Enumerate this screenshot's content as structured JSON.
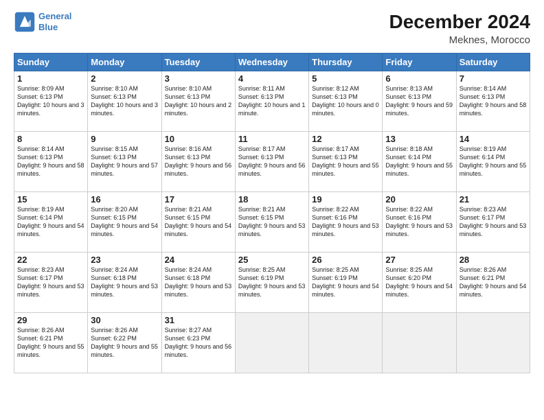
{
  "header": {
    "logo_line1": "General",
    "logo_line2": "Blue",
    "month": "December 2024",
    "location": "Meknes, Morocco"
  },
  "weekdays": [
    "Sunday",
    "Monday",
    "Tuesday",
    "Wednesday",
    "Thursday",
    "Friday",
    "Saturday"
  ],
  "weeks": [
    [
      {
        "num": "1",
        "sunrise": "8:09 AM",
        "sunset": "6:13 PM",
        "daylight": "10 hours and 3 minutes."
      },
      {
        "num": "2",
        "sunrise": "8:10 AM",
        "sunset": "6:13 PM",
        "daylight": "10 hours and 3 minutes."
      },
      {
        "num": "3",
        "sunrise": "8:10 AM",
        "sunset": "6:13 PM",
        "daylight": "10 hours and 2 minutes."
      },
      {
        "num": "4",
        "sunrise": "8:11 AM",
        "sunset": "6:13 PM",
        "daylight": "10 hours and 1 minute."
      },
      {
        "num": "5",
        "sunrise": "8:12 AM",
        "sunset": "6:13 PM",
        "daylight": "10 hours and 0 minutes."
      },
      {
        "num": "6",
        "sunrise": "8:13 AM",
        "sunset": "6:13 PM",
        "daylight": "9 hours and 59 minutes."
      },
      {
        "num": "7",
        "sunrise": "8:14 AM",
        "sunset": "6:13 PM",
        "daylight": "9 hours and 58 minutes."
      }
    ],
    [
      {
        "num": "8",
        "sunrise": "8:14 AM",
        "sunset": "6:13 PM",
        "daylight": "9 hours and 58 minutes."
      },
      {
        "num": "9",
        "sunrise": "8:15 AM",
        "sunset": "6:13 PM",
        "daylight": "9 hours and 57 minutes."
      },
      {
        "num": "10",
        "sunrise": "8:16 AM",
        "sunset": "6:13 PM",
        "daylight": "9 hours and 56 minutes."
      },
      {
        "num": "11",
        "sunrise": "8:17 AM",
        "sunset": "6:13 PM",
        "daylight": "9 hours and 56 minutes."
      },
      {
        "num": "12",
        "sunrise": "8:17 AM",
        "sunset": "6:13 PM",
        "daylight": "9 hours and 55 minutes."
      },
      {
        "num": "13",
        "sunrise": "8:18 AM",
        "sunset": "6:14 PM",
        "daylight": "9 hours and 55 minutes."
      },
      {
        "num": "14",
        "sunrise": "8:19 AM",
        "sunset": "6:14 PM",
        "daylight": "9 hours and 55 minutes."
      }
    ],
    [
      {
        "num": "15",
        "sunrise": "8:19 AM",
        "sunset": "6:14 PM",
        "daylight": "9 hours and 54 minutes."
      },
      {
        "num": "16",
        "sunrise": "8:20 AM",
        "sunset": "6:15 PM",
        "daylight": "9 hours and 54 minutes."
      },
      {
        "num": "17",
        "sunrise": "8:21 AM",
        "sunset": "6:15 PM",
        "daylight": "9 hours and 54 minutes."
      },
      {
        "num": "18",
        "sunrise": "8:21 AM",
        "sunset": "6:15 PM",
        "daylight": "9 hours and 53 minutes."
      },
      {
        "num": "19",
        "sunrise": "8:22 AM",
        "sunset": "6:16 PM",
        "daylight": "9 hours and 53 minutes."
      },
      {
        "num": "20",
        "sunrise": "8:22 AM",
        "sunset": "6:16 PM",
        "daylight": "9 hours and 53 minutes."
      },
      {
        "num": "21",
        "sunrise": "8:23 AM",
        "sunset": "6:17 PM",
        "daylight": "9 hours and 53 minutes."
      }
    ],
    [
      {
        "num": "22",
        "sunrise": "8:23 AM",
        "sunset": "6:17 PM",
        "daylight": "9 hours and 53 minutes."
      },
      {
        "num": "23",
        "sunrise": "8:24 AM",
        "sunset": "6:18 PM",
        "daylight": "9 hours and 53 minutes."
      },
      {
        "num": "24",
        "sunrise": "8:24 AM",
        "sunset": "6:18 PM",
        "daylight": "9 hours and 53 minutes."
      },
      {
        "num": "25",
        "sunrise": "8:25 AM",
        "sunset": "6:19 PM",
        "daylight": "9 hours and 53 minutes."
      },
      {
        "num": "26",
        "sunrise": "8:25 AM",
        "sunset": "6:19 PM",
        "daylight": "9 hours and 54 minutes."
      },
      {
        "num": "27",
        "sunrise": "8:25 AM",
        "sunset": "6:20 PM",
        "daylight": "9 hours and 54 minutes."
      },
      {
        "num": "28",
        "sunrise": "8:26 AM",
        "sunset": "6:21 PM",
        "daylight": "9 hours and 54 minutes."
      }
    ],
    [
      {
        "num": "29",
        "sunrise": "8:26 AM",
        "sunset": "6:21 PM",
        "daylight": "9 hours and 55 minutes."
      },
      {
        "num": "30",
        "sunrise": "8:26 AM",
        "sunset": "6:22 PM",
        "daylight": "9 hours and 55 minutes."
      },
      {
        "num": "31",
        "sunrise": "8:27 AM",
        "sunset": "6:23 PM",
        "daylight": "9 hours and 56 minutes."
      },
      null,
      null,
      null,
      null
    ]
  ]
}
